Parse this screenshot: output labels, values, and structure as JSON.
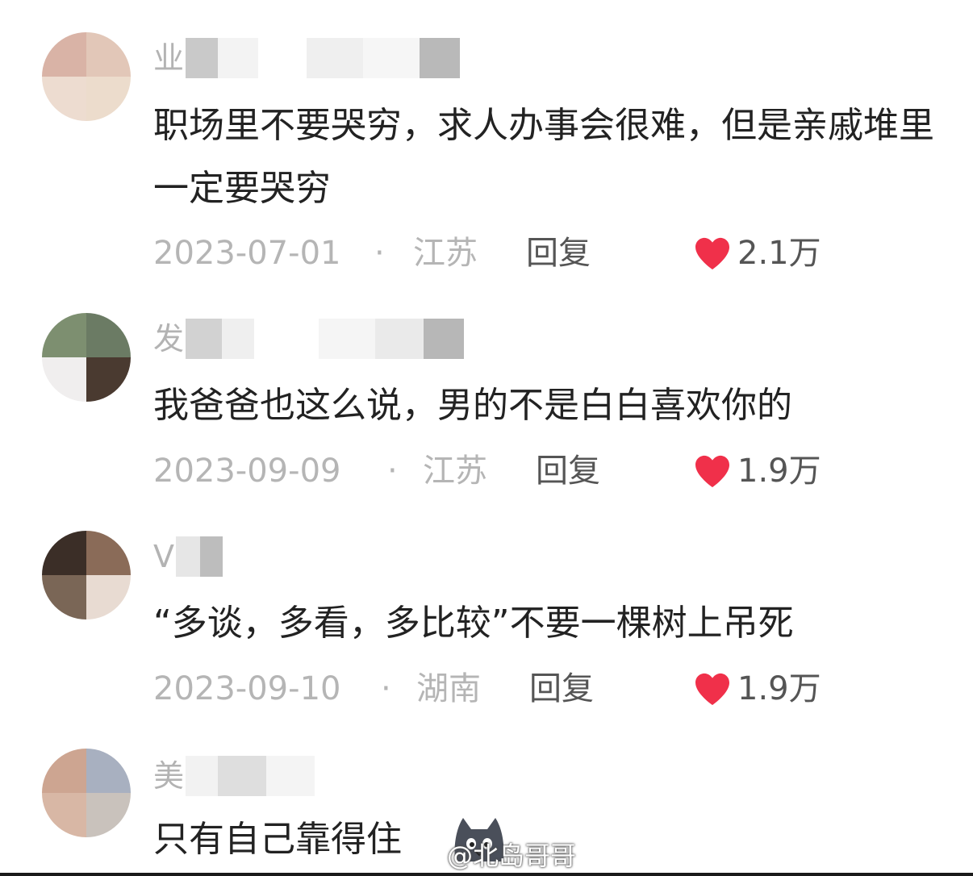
{
  "comments": [
    {
      "username": "业",
      "text": "职场里不要哭穷，求人办事会很难，但是亲戚堆里一定要哭穷",
      "date": "2023-07-01",
      "location": "江苏",
      "reply": "回复",
      "likes": "2.1万"
    },
    {
      "username": "发",
      "text": "我爸爸也这么说，男的不是白白喜欢你的",
      "date": "2023-09-09",
      "location": "江苏",
      "reply": "回复",
      "likes": "1.9万"
    },
    {
      "username": "V",
      "text": "“多谈，多看，多比较”不要一棵树上吊死",
      "date": "2023-09-10",
      "location": "湖南",
      "reply": "回复",
      "likes": "1.9万"
    },
    {
      "username": "美",
      "text": "只有自己靠得住"
    }
  ],
  "separator": "·",
  "watermark": "@北岛哥哥",
  "icons": {
    "like": "heart-icon",
    "watermark": "weibo-logo-icon",
    "sticker": "cat-sticker-icon"
  },
  "colors": {
    "heart": "#f0304a",
    "meta_text": "#b5b5b5",
    "body_text": "#222222"
  }
}
